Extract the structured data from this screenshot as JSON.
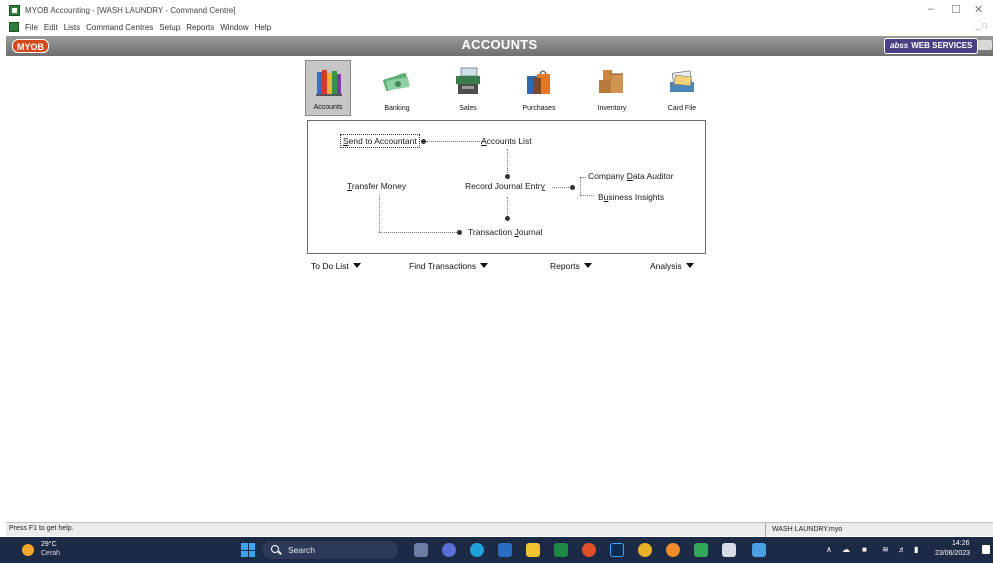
{
  "window": {
    "title": "MYOB Accounting - [WASH LAUNDRY - Command Centre]",
    "minimize": "–",
    "restore": "☐",
    "close": "✕"
  },
  "menu": [
    "File",
    "Edit",
    "Lists",
    "Command Centres",
    "Setup",
    "Reports",
    "Window",
    "Help"
  ],
  "header": {
    "logo": "MYOB",
    "title": "ACCOUNTS",
    "abss_prefix": "abss",
    "abss_label": "WEB SERVICES"
  },
  "modules": [
    {
      "label": "Accounts",
      "icon": "accounts-books-icon",
      "active": true
    },
    {
      "label": "Banking",
      "icon": "banking-money-icon",
      "active": false
    },
    {
      "label": "Sales",
      "icon": "sales-register-icon",
      "active": false
    },
    {
      "label": "Purchases",
      "icon": "purchases-bags-icon",
      "active": false
    },
    {
      "label": "Inventory",
      "icon": "inventory-boxes-icon",
      "active": false
    },
    {
      "label": "Card File",
      "icon": "card-file-icon",
      "active": false
    }
  ],
  "flow": {
    "send_to_accountant": {
      "pre": "",
      "u": "S",
      "post": "end to Accountant"
    },
    "accounts_list": {
      "pre": "",
      "u": "A",
      "post": "ccounts List"
    },
    "transfer_money": {
      "pre": "",
      "u": "T",
      "post": "ransfer Money"
    },
    "record_journal_entry": {
      "pre": "Record Journal Entr",
      "u": "y",
      "post": ""
    },
    "company_data_auditor": {
      "pre": "Company ",
      "u": "D",
      "post": "ata Auditor"
    },
    "business_insights": {
      "pre": "B",
      "u": "u",
      "post": "siness Insights"
    },
    "transaction_journal": {
      "pre": "Transaction ",
      "u": "J",
      "post": "ournal"
    }
  },
  "dropdowns": [
    "To Do List",
    "Find Transactions",
    "Reports",
    "Analysis"
  ],
  "status": {
    "help": "Press F1 to get help.",
    "file": "WASH LAUNDRY.myo"
  },
  "taskbar": {
    "temp": "29°C",
    "weather": "Cerah",
    "search": "Search",
    "time": "14:26",
    "date": "23/06/2023",
    "tray_up": "∧"
  },
  "colors": {
    "header_gray": "#7e7e7e",
    "myob_orange": "#d54a1c",
    "abss_purple": "#4a3f84",
    "taskbar_navy": "#1d2a45"
  }
}
